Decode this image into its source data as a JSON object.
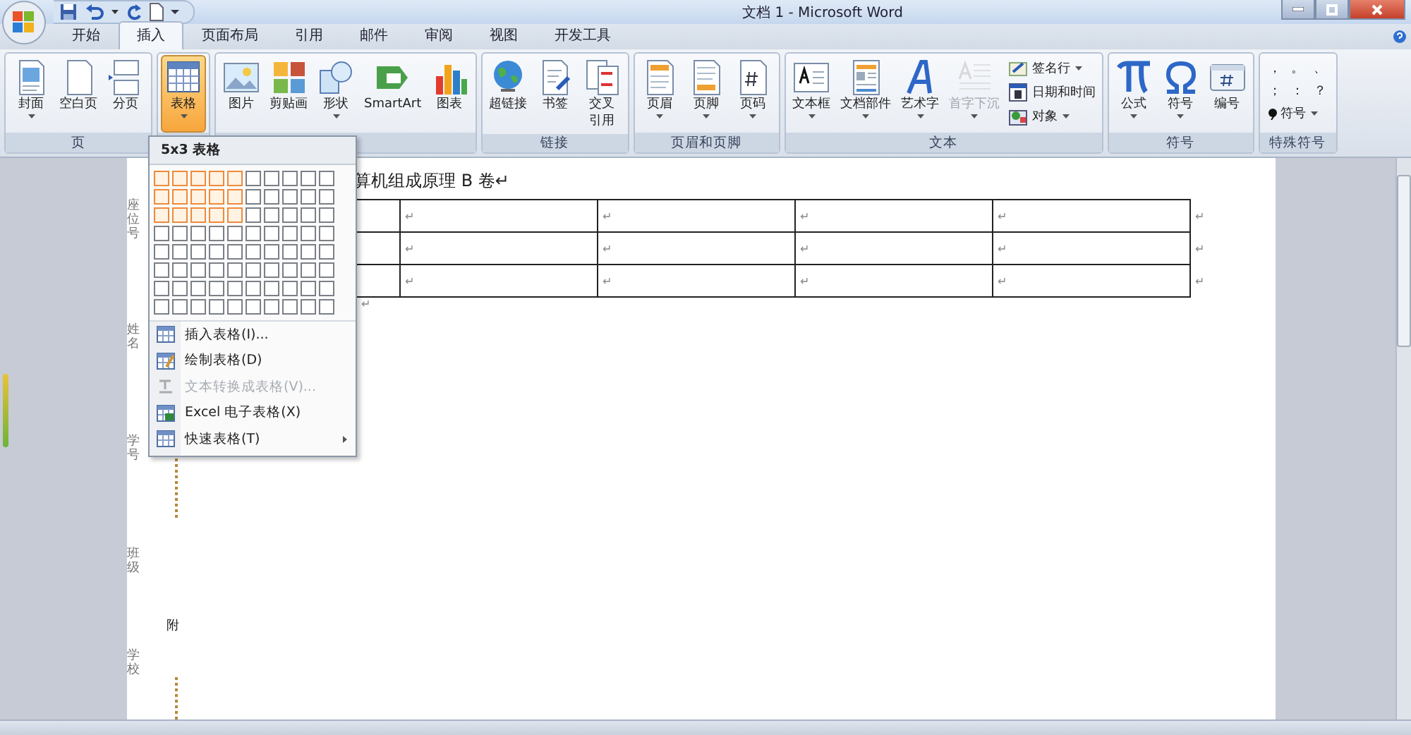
{
  "window": {
    "title": "文档 1 - Microsoft Word"
  },
  "tabs": [
    {
      "label": "开始",
      "selected": false
    },
    {
      "label": "插入",
      "selected": true
    },
    {
      "label": "页面布局",
      "selected": false
    },
    {
      "label": "引用",
      "selected": false
    },
    {
      "label": "邮件",
      "selected": false
    },
    {
      "label": "审阅",
      "selected": false
    },
    {
      "label": "视图",
      "selected": false
    },
    {
      "label": "开发工具",
      "selected": false
    }
  ],
  "ribbon_groups": [
    {
      "label": "页",
      "buttons": [
        {
          "label": "封面",
          "dropdown": true,
          "pressed": false,
          "disabled": false
        },
        {
          "label": "空白页",
          "dropdown": false,
          "pressed": false,
          "disabled": false
        },
        {
          "label": "分页",
          "dropdown": false,
          "pressed": false,
          "disabled": false
        }
      ]
    },
    {
      "buttons": [
        {
          "label": "表格",
          "dropdown": true,
          "pressed": true,
          "disabled": false
        }
      ]
    },
    {
      "buttons": [
        {
          "label": "图片",
          "dropdown": false,
          "pressed": false,
          "disabled": false
        },
        {
          "label": "剪贴画",
          "dropdown": false,
          "pressed": false,
          "disabled": false
        },
        {
          "label": "形状",
          "dropdown": true,
          "pressed": false,
          "disabled": false
        },
        {
          "label": "SmartArt",
          "dropdown": false,
          "pressed": false,
          "disabled": false
        },
        {
          "label": "图表",
          "dropdown": false,
          "pressed": false,
          "disabled": false
        }
      ]
    },
    {
      "label": "链接",
      "buttons": [
        {
          "label": "超链接",
          "dropdown": false,
          "pressed": false,
          "disabled": false
        },
        {
          "label": "书签",
          "dropdown": false,
          "pressed": false,
          "disabled": false
        },
        {
          "label": [
            "交叉",
            "引用"
          ],
          "dropdown": false,
          "pressed": false,
          "disabled": false
        }
      ]
    },
    {
      "label": "页眉和页脚",
      "buttons": [
        {
          "label": "页眉",
          "dropdown": true,
          "pressed": false,
          "disabled": false
        },
        {
          "label": "页脚",
          "dropdown": true,
          "pressed": false,
          "disabled": false
        },
        {
          "label": "页码",
          "dropdown": true,
          "pressed": false,
          "disabled": false
        }
      ]
    },
    {
      "label": "文本",
      "buttons": [
        {
          "label": "文本框",
          "dropdown": true,
          "pressed": false,
          "disabled": false
        },
        {
          "label": "文档部件",
          "dropdown": true,
          "pressed": false,
          "disabled": false
        },
        {
          "label": "艺术字",
          "dropdown": true,
          "pressed": false,
          "disabled": false
        },
        {
          "label": "首字下沉",
          "dropdown": true,
          "pressed": false,
          "disabled": true
        }
      ],
      "small_buttons": [
        {
          "label": "签名行",
          "dropdown": true
        },
        {
          "label": "日期和时间",
          "dropdown": false
        },
        {
          "label": "对象",
          "dropdown": true
        }
      ]
    },
    {
      "label": "符号",
      "buttons": [
        {
          "label": "公式",
          "dropdown": true,
          "pressed": false,
          "disabled": false
        },
        {
          "label": "符号",
          "dropdown": true,
          "pressed": false,
          "disabled": false
        },
        {
          "label": "编号",
          "dropdown": false,
          "pressed": false,
          "disabled": false
        }
      ]
    },
    {
      "label": "特殊符号",
      "symbols": [
        "，",
        "。",
        "、",
        "；",
        "：",
        "？"
      ],
      "small_buttons": [
        {
          "label": "符号",
          "dropdown": true
        }
      ]
    }
  ],
  "table_menu": {
    "header": "5x3 表格",
    "grid": [
      [
        {
          "selected": true
        },
        {
          "selected": true
        },
        {
          "selected": true
        },
        {
          "selected": true
        },
        {
          "selected": true
        },
        {
          "selected": false
        },
        {
          "selected": false
        },
        {
          "selected": false
        },
        {
          "selected": false
        },
        {
          "selected": false
        }
      ],
      [
        {
          "selected": true
        },
        {
          "selected": true
        },
        {
          "selected": true
        },
        {
          "selected": true
        },
        {
          "selected": true
        },
        {
          "selected": false
        },
        {
          "selected": false
        },
        {
          "selected": false
        },
        {
          "selected": false
        },
        {
          "selected": false
        }
      ],
      [
        {
          "selected": true
        },
        {
          "selected": true
        },
        {
          "selected": true
        },
        {
          "selected": true
        },
        {
          "selected": true
        },
        {
          "selected": false
        },
        {
          "selected": false
        },
        {
          "selected": false
        },
        {
          "selected": false
        },
        {
          "selected": false
        }
      ],
      [
        {
          "selected": false
        },
        {
          "selected": false
        },
        {
          "selected": false
        },
        {
          "selected": false
        },
        {
          "selected": false
        },
        {
          "selected": false
        },
        {
          "selected": false
        },
        {
          "selected": false
        },
        {
          "selected": false
        },
        {
          "selected": false
        }
      ],
      [
        {
          "selected": false
        },
        {
          "selected": false
        },
        {
          "selected": false
        },
        {
          "selected": false
        },
        {
          "selected": false
        },
        {
          "selected": false
        },
        {
          "selected": false
        },
        {
          "selected": false
        },
        {
          "selected": false
        },
        {
          "selected": false
        }
      ],
      [
        {
          "selected": false
        },
        {
          "selected": false
        },
        {
          "selected": false
        },
        {
          "selected": false
        },
        {
          "selected": false
        },
        {
          "selected": false
        },
        {
          "selected": false
        },
        {
          "selected": false
        },
        {
          "selected": false
        },
        {
          "selected": false
        }
      ],
      [
        {
          "selected": false
        },
        {
          "selected": false
        },
        {
          "selected": false
        },
        {
          "selected": false
        },
        {
          "selected": false
        },
        {
          "selected": false
        },
        {
          "selected": false
        },
        {
          "selected": false
        },
        {
          "selected": false
        },
        {
          "selected": false
        }
      ],
      [
        {
          "selected": false
        },
        {
          "selected": false
        },
        {
          "selected": false
        },
        {
          "selected": false
        },
        {
          "selected": false
        },
        {
          "selected": false
        },
        {
          "selected": false
        },
        {
          "selected": false
        },
        {
          "selected": false
        },
        {
          "selected": false
        }
      ]
    ],
    "items": [
      {
        "label": "插入表格(I)...",
        "disabled": false,
        "submenu": false
      },
      {
        "label": "绘制表格(D)",
        "disabled": false,
        "submenu": false
      },
      {
        "label": "文本转换成表格(V)...",
        "disabled": true,
        "submenu": false
      },
      {
        "label": "Excel 电子表格(X)",
        "disabled": false,
        "submenu": false
      },
      {
        "label": "快速表格(T)",
        "disabled": false,
        "submenu": true
      }
    ]
  },
  "document": {
    "title": "算机组成原理 B 卷↵",
    "margin_labels": [
      "座位号",
      "姓名",
      "学号",
      "班级",
      "学校"
    ],
    "margin_note": "附",
    "table": {
      "rows": [
        {
          "cells": [
            "↵",
            "↵",
            "↵",
            "↵"
          ],
          "end": "↵"
        },
        {
          "cells": [
            "↵",
            "↵",
            "↵",
            "↵"
          ],
          "end": "↵"
        },
        {
          "cells": [
            "↵",
            "↵",
            "↵",
            "↵"
          ],
          "end": "↵"
        }
      ]
    },
    "after_table": "↵"
  }
}
